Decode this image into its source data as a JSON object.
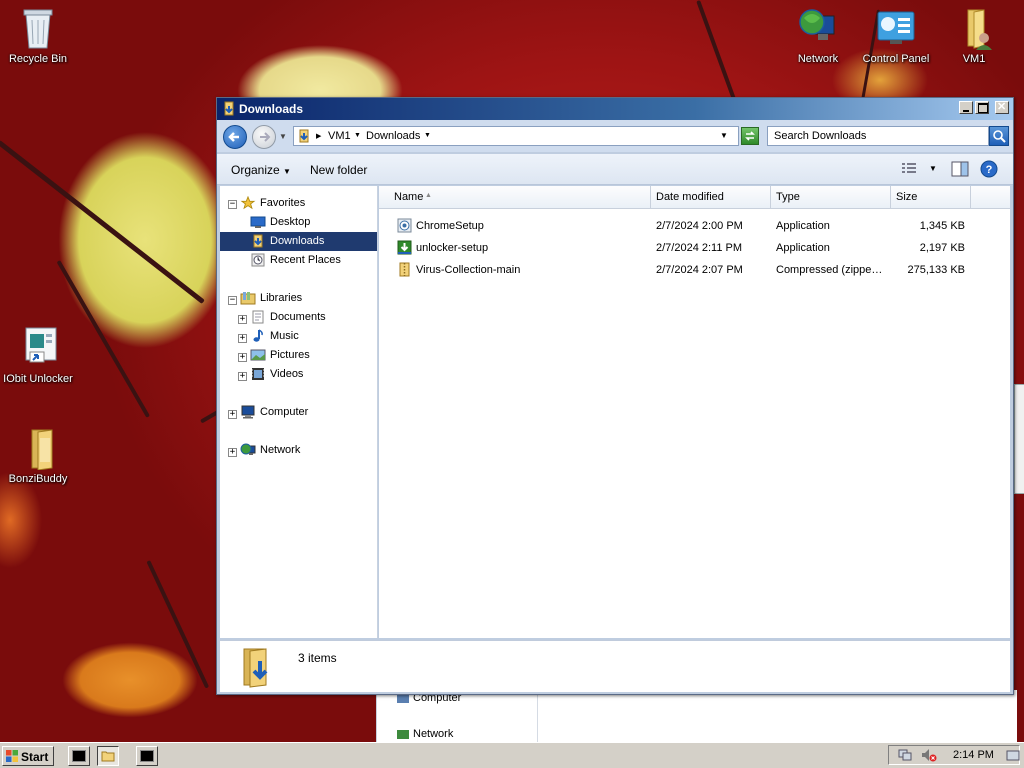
{
  "desktop": {
    "icons": [
      {
        "label": "Recycle Bin",
        "icon": "recycle-bin-icon"
      },
      {
        "label": "Network",
        "icon": "network-icon"
      },
      {
        "label": "Control Panel",
        "icon": "control-panel-icon"
      },
      {
        "label": "VM1",
        "icon": "user-folder-icon"
      },
      {
        "label": "IObit Unlocker",
        "icon": "shortcut-icon"
      },
      {
        "label": "BonziBuddy",
        "icon": "folder-icon"
      }
    ]
  },
  "background_window": {
    "items": [
      "Computer",
      "Network"
    ]
  },
  "window": {
    "title": "Downloads",
    "breadcrumb": [
      "VM1",
      "Downloads"
    ],
    "search_placeholder": "Search Downloads",
    "toolbar": {
      "organize": "Organize",
      "new_folder": "New folder"
    },
    "nav": {
      "favorites": "Favorites",
      "desktop": "Desktop",
      "downloads": "Downloads",
      "recent_places": "Recent Places",
      "libraries": "Libraries",
      "documents": "Documents",
      "music": "Music",
      "pictures": "Pictures",
      "videos": "Videos",
      "computer": "Computer",
      "network": "Network"
    },
    "columns": {
      "name": "Name",
      "date": "Date modified",
      "type": "Type",
      "size": "Size"
    },
    "files": [
      {
        "name": "ChromeSetup",
        "date": "2/7/2024 2:00 PM",
        "type": "Application",
        "size": "1,345 KB",
        "icon": "chrome-setup-icon"
      },
      {
        "name": "unlocker-setup",
        "date": "2/7/2024 2:11 PM",
        "type": "Application",
        "size": "2,197 KB",
        "icon": "installer-icon"
      },
      {
        "name": "Virus-Collection-main",
        "date": "2/7/2024 2:07 PM",
        "type": "Compressed (zippe…",
        "size": "275,133 KB",
        "icon": "zip-folder-icon"
      }
    ],
    "status": "3 items"
  },
  "taskbar": {
    "start": "Start",
    "clock": "2:14 PM"
  }
}
